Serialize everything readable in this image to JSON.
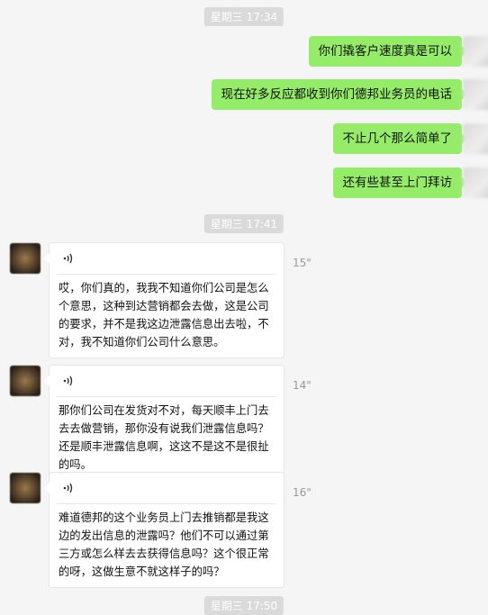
{
  "timestamps": [
    "星期三 17:34",
    "星期三 17:41",
    "星期三 17:50"
  ],
  "sent_messages": [
    "你们撬客户速度真是可以",
    "现在好多反应都收到你们德邦业务员的电话",
    "不止几个那么简单了",
    "还有些甚至上门拜访"
  ],
  "voice_messages": [
    {
      "duration": "15\"",
      "transcript": "哎，你们真的，我我不知道你们公司是怎么个意思，这种到达营销都会去做，这是公司的要求，并不是我这边泄露信息出去啦，不对，我不知道你们公司什么意思。"
    },
    {
      "duration": "14\"",
      "transcript": "那你们公司在发货对不对，每天顺丰上门去去去做营销，那你没有说我们泄露信息吗？还是顺丰泄露信息啊，这这不是这不是很扯的吗。"
    },
    {
      "duration": "16\"",
      "transcript": "难道德邦的这个业务员上门去推销都是我这边的发出信息的泄露吗？他们不可以通过第三方或怎么样去去获得信息吗？这个很正常的呀，这做生意不就这样子的吗？"
    }
  ],
  "icons": {
    "voice": "voice-wave-icon"
  },
  "colors": {
    "background": "#f5f5f5",
    "sent_bubble": "#95ec69",
    "received_bubble": "#ffffff",
    "timestamp_bg": "#dadada"
  }
}
